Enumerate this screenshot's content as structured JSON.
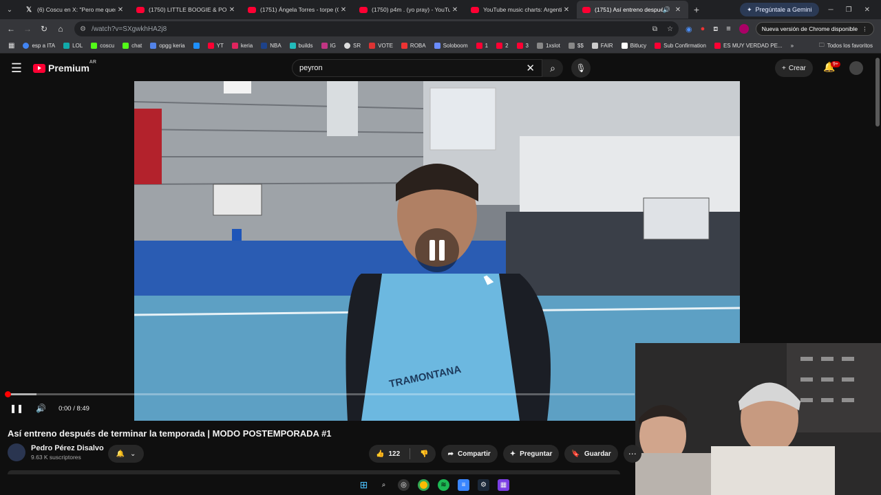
{
  "browser": {
    "tabs": [
      {
        "title": "(6) Coscu en X: \"Pero me quería",
        "favicon": "x-icon"
      },
      {
        "title": "(1750) LITTLE BOOGIE & POST",
        "favicon": "youtube-icon"
      },
      {
        "title": "(1751) Ángela Torres - torpe (O",
        "favicon": "youtube-icon"
      },
      {
        "title": "(1750) p4m . (yo pray) - YouTub",
        "favicon": "youtube-icon"
      },
      {
        "title": "YouTube music charts: Argentin",
        "favicon": "youtube-icon"
      },
      {
        "title": "(1751) Así entreno despué",
        "favicon": "youtube-icon",
        "active": true,
        "audio": true
      }
    ],
    "gemini_label": "Pregúntale a Gemini",
    "url_host": "youtube.com",
    "url_path": "/watch?v=SXgwkhHA2j8",
    "update_label": "Nueva versión de Chrome disponible",
    "bookmarks": [
      "esp a ITA",
      "LOL",
      "coscu",
      "chat",
      "opgg keria",
      "",
      "YT",
      "keria",
      "NBA",
      "builds",
      "IG",
      "SR",
      "VOTE",
      "ROBA",
      "Soloboom",
      "1",
      "2",
      "3",
      "1xslot",
      "$$",
      "FAIR",
      "Bitlucy",
      "Sub Confirmation",
      "ES MUY VERDAD PE..."
    ],
    "bookmarks_all": "Todos los favoritos"
  },
  "youtube": {
    "logo_text": "Premium",
    "region": "AR",
    "search_value": "peyron",
    "create_label": "Crear",
    "notif_count": "9+",
    "player": {
      "time": "0:00 / 8:49",
      "progress": 0.004
    },
    "video_title": "Así entreno después de terminar la temporada | MODO POSTEMPORADA #1",
    "channel_name": "Pedro Pérez Disalvo",
    "subscribers": "9.63 K suscriptores",
    "likes": "122",
    "share_label": "Compartir",
    "ask_label": "Preguntar",
    "save_label": "Guardar",
    "jersey_text": "TRAMONTANA"
  },
  "colors": {
    "brand_red": "#ff0033",
    "background": "#0f0f0f",
    "court_blue": "#5da0c4"
  }
}
